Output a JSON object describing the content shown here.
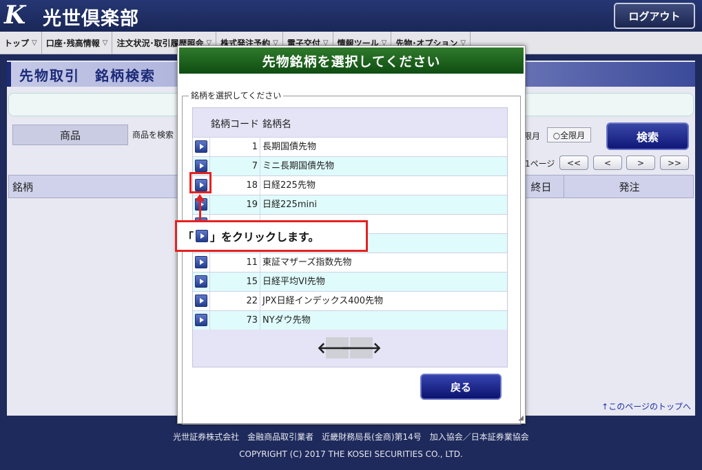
{
  "header": {
    "logo_letter": "K",
    "brand": "光世倶楽部",
    "logout_label": "ログアウト"
  },
  "nav": {
    "items": [
      {
        "label": "トップ"
      },
      {
        "label": "口座･残高情報"
      },
      {
        "label": "注文状況･取引履歴照会"
      },
      {
        "label": "株式発注予約"
      },
      {
        "label": "電子交付"
      },
      {
        "label": "情報ツール"
      },
      {
        "label": "先物･オプション"
      }
    ],
    "caret": "▽"
  },
  "main": {
    "page_title": "先物取引　銘柄検索",
    "product_label": "商品",
    "product_hint": "商品を検索",
    "month_text": "限月",
    "all_months_option": "○全限月",
    "search_label": "検索",
    "page_label": "1ページ",
    "pager": {
      "first": "<<",
      "prev": "<",
      "next": ">",
      "last": ">>"
    },
    "grid_headers": {
      "brand": "銘柄",
      "last_day": "終日",
      "order": "発注"
    },
    "page_top_link": "↑このページのトップへ"
  },
  "modal": {
    "title": "先物銘柄を選択してください",
    "legend": "銘柄を選択してください",
    "col_code": "銘柄コード",
    "col_name": "銘柄名",
    "rows": [
      {
        "code": "1",
        "name": "長期国債先物"
      },
      {
        "code": "7",
        "name": "ミニ長期国債先物"
      },
      {
        "code": "18",
        "name": "日経225先物"
      },
      {
        "code": "19",
        "name": "日経225mini"
      },
      {
        "code": "",
        "name": ""
      },
      {
        "code": "",
        "name": ""
      },
      {
        "code": "11",
        "name": "東証マザーズ指数先物"
      },
      {
        "code": "15",
        "name": "日経平均VI先物"
      },
      {
        "code": "22",
        "name": "JPX日経インデックス400先物"
      },
      {
        "code": "73",
        "name": "NYダウ先物"
      }
    ],
    "prev_arrow": "🡐",
    "next_arrow": "🡒",
    "back_label": "戻る"
  },
  "annotation": {
    "open_bracket": "「",
    "close_text": "」をクリックします。"
  },
  "footer": {
    "line1": "光世証券株式会社　金融商品取引業者　近畿財務局長(金商)第14号　加入協会／日本証券業協会",
    "line2": "COPYRIGHT (C) 2017 THE KOSEI SECURITIES CO., LTD."
  },
  "colors": {
    "header_bg": "#1e2a5c",
    "modal_header": "#0f4d12",
    "row_alt": "#dffbfb",
    "annotation_red": "#e52121",
    "button_blue": "#0c136e"
  }
}
